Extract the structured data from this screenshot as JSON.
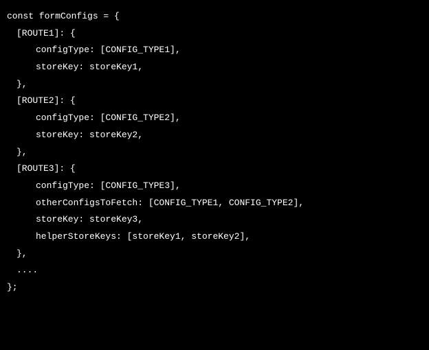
{
  "code": {
    "line1": "const formConfigs = {",
    "line2": "[ROUTE1]: {",
    "line3": "configType: [CONFIG_TYPE1],",
    "line4": "storeKey: storeKey1,",
    "line5": "},",
    "line6": "[ROUTE2]: {",
    "line7": "configType: [CONFIG_TYPE2],",
    "line8": "storeKey: storeKey2,",
    "line9": "},",
    "line10": "[ROUTE3]: {",
    "line11": "configType: [CONFIG_TYPE3],",
    "line12": "otherConfigsToFetch: [CONFIG_TYPE1, CONFIG_TYPE2],",
    "line13": "storeKey: storeKey3,",
    "line14": "helperStoreKeys: [storeKey1, storeKey2],",
    "line15": "},",
    "line16": "....",
    "line17": "};"
  }
}
